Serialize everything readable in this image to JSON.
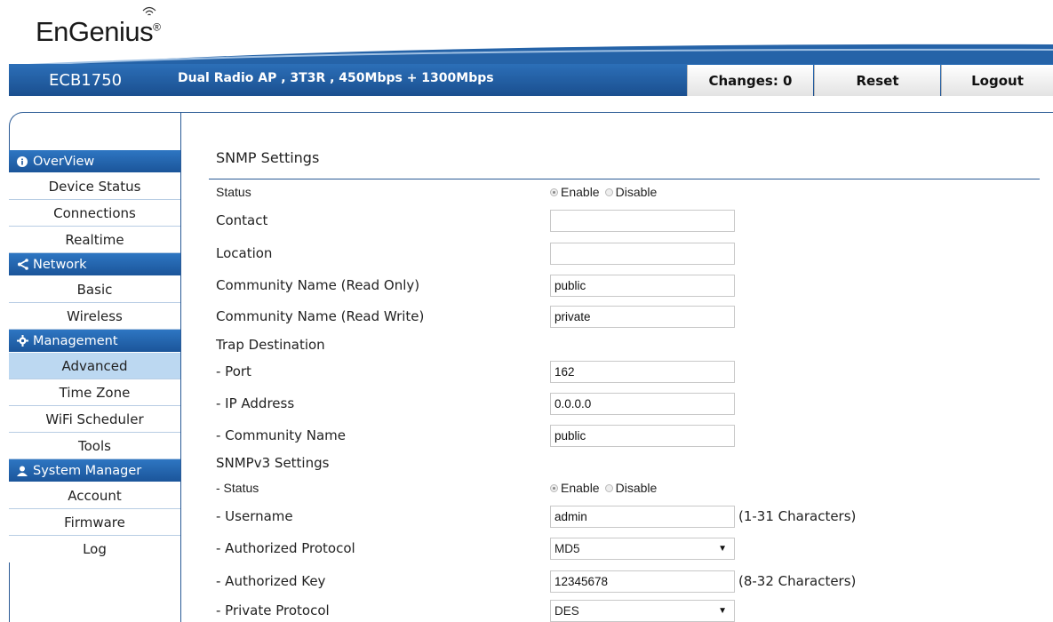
{
  "brand": {
    "name": "EnGenius",
    "reg": "®"
  },
  "header": {
    "model": "ECB1750",
    "description": "Dual Radio AP , 3T3R , 450Mbps + 1300Mbps",
    "changes_label": "Changes: 0",
    "reset_label": "Reset",
    "logout_label": "Logout"
  },
  "sidebar": {
    "sections": [
      {
        "title": "OverView",
        "icon": "info-icon",
        "items": [
          "Device Status",
          "Connections",
          "Realtime"
        ]
      },
      {
        "title": "Network",
        "icon": "share-icon",
        "items": [
          "Basic",
          "Wireless"
        ]
      },
      {
        "title": "Management",
        "icon": "gear-icon",
        "items": [
          "Advanced",
          "Time Zone",
          "WiFi Scheduler",
          "Tools"
        ]
      },
      {
        "title": "System Manager",
        "icon": "user-icon",
        "items": [
          "Account",
          "Firmware",
          "Log"
        ]
      }
    ],
    "active_item": "Advanced"
  },
  "main": {
    "title": "SNMP Settings",
    "status": {
      "label": "Status",
      "enable": "Enable",
      "disable": "Disable",
      "selected": "Enable"
    },
    "contact": {
      "label": "Contact",
      "value": ""
    },
    "location": {
      "label": "Location",
      "value": ""
    },
    "community_ro": {
      "label": "Community Name (Read Only)",
      "value": "public"
    },
    "community_rw": {
      "label": "Community Name (Read Write)",
      "value": "private"
    },
    "trap": {
      "label": "Trap Destination",
      "port": {
        "label": "- Port",
        "value": "162"
      },
      "ip": {
        "label": "- IP Address",
        "value": "0.0.0.0"
      },
      "community": {
        "label": "- Community Name",
        "value": "public"
      }
    },
    "snmpv3": {
      "label": "SNMPv3 Settings",
      "status": {
        "label": "- Status",
        "enable": "Enable",
        "disable": "Disable",
        "selected": "Enable"
      },
      "username": {
        "label": "- Username",
        "value": "admin",
        "hint": "(1-31 Characters)"
      },
      "auth_protocol": {
        "label": "- Authorized Protocol",
        "value": "MD5"
      },
      "auth_key": {
        "label": "- Authorized Key",
        "value": "12345678",
        "hint": "(8-32 Characters)"
      },
      "priv_protocol": {
        "label": "- Private Protocol",
        "value": "DES"
      }
    }
  },
  "colors": {
    "accent": "#1e5aa0",
    "active_bg": "#bcd8f1"
  }
}
